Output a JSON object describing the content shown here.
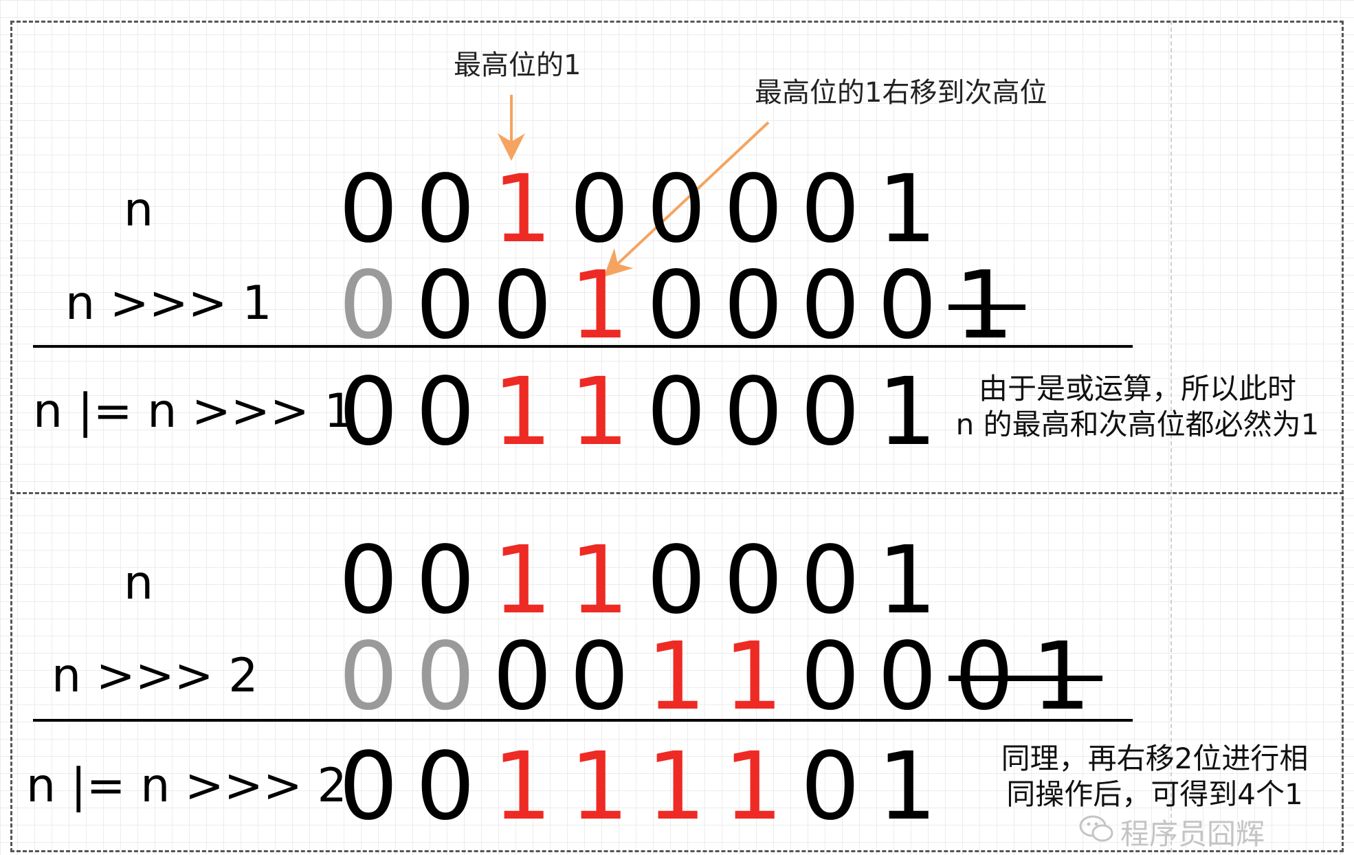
{
  "callouts": {
    "top_bit": "最高位的1",
    "shift": "最高位的1右移到次高位"
  },
  "notes": {
    "or_line1": "由于是或运算，所以此时",
    "or_line2": "n 的最高和次高位都必然为1",
    "same_line1": "同理，再右移2位进行相",
    "same_line2": "同操作后，可得到4个1"
  },
  "rows": [
    {
      "label": "n",
      "digits": [
        {
          "v": "0",
          "c": "black"
        },
        {
          "v": "0",
          "c": "black"
        },
        {
          "v": "1",
          "c": "red"
        },
        {
          "v": "0",
          "c": "black"
        },
        {
          "v": "0",
          "c": "black"
        },
        {
          "v": "0",
          "c": "black"
        },
        {
          "v": "0",
          "c": "black"
        },
        {
          "v": "1",
          "c": "black"
        }
      ]
    },
    {
      "label": "n >>> 1",
      "digits": [
        {
          "v": "0",
          "c": "gray"
        },
        {
          "v": "0",
          "c": "black"
        },
        {
          "v": "0",
          "c": "black"
        },
        {
          "v": "1",
          "c": "red"
        },
        {
          "v": "0",
          "c": "black"
        },
        {
          "v": "0",
          "c": "black"
        },
        {
          "v": "0",
          "c": "black"
        },
        {
          "v": "0",
          "c": "black"
        },
        {
          "v": "1",
          "c": "black",
          "struck": true
        }
      ]
    },
    {
      "label": "n |= n >>> 1",
      "digits": [
        {
          "v": "0",
          "c": "black"
        },
        {
          "v": "0",
          "c": "black"
        },
        {
          "v": "1",
          "c": "red"
        },
        {
          "v": "1",
          "c": "red"
        },
        {
          "v": "0",
          "c": "black"
        },
        {
          "v": "0",
          "c": "black"
        },
        {
          "v": "0",
          "c": "black"
        },
        {
          "v": "1",
          "c": "black"
        }
      ]
    },
    {
      "label": "n",
      "digits": [
        {
          "v": "0",
          "c": "black"
        },
        {
          "v": "0",
          "c": "black"
        },
        {
          "v": "1",
          "c": "red"
        },
        {
          "v": "1",
          "c": "red"
        },
        {
          "v": "0",
          "c": "black"
        },
        {
          "v": "0",
          "c": "black"
        },
        {
          "v": "0",
          "c": "black"
        },
        {
          "v": "1",
          "c": "black"
        }
      ]
    },
    {
      "label": "n >>> 2",
      "digits": [
        {
          "v": "0",
          "c": "gray"
        },
        {
          "v": "0",
          "c": "gray"
        },
        {
          "v": "0",
          "c": "black"
        },
        {
          "v": "0",
          "c": "black"
        },
        {
          "v": "1",
          "c": "red"
        },
        {
          "v": "1",
          "c": "red"
        },
        {
          "v": "0",
          "c": "black"
        },
        {
          "v": "0",
          "c": "black"
        },
        {
          "v": "0",
          "c": "black",
          "struck": true
        },
        {
          "v": "1",
          "c": "black",
          "struck": true
        }
      ]
    },
    {
      "label": "n |= n >>> 2",
      "digits": [
        {
          "v": "0",
          "c": "black"
        },
        {
          "v": "0",
          "c": "black"
        },
        {
          "v": "1",
          "c": "red"
        },
        {
          "v": "1",
          "c": "red"
        },
        {
          "v": "1",
          "c": "red"
        },
        {
          "v": "1",
          "c": "red"
        },
        {
          "v": "0",
          "c": "black"
        },
        {
          "v": "1",
          "c": "black"
        }
      ]
    }
  ],
  "colors": {
    "red": "#ee2a24",
    "gray": "#9a9a9a",
    "black": "#000000",
    "arrow": "#f4a460"
  },
  "watermark": {
    "icon": "wechat-icon",
    "text": "程序员囧辉"
  }
}
